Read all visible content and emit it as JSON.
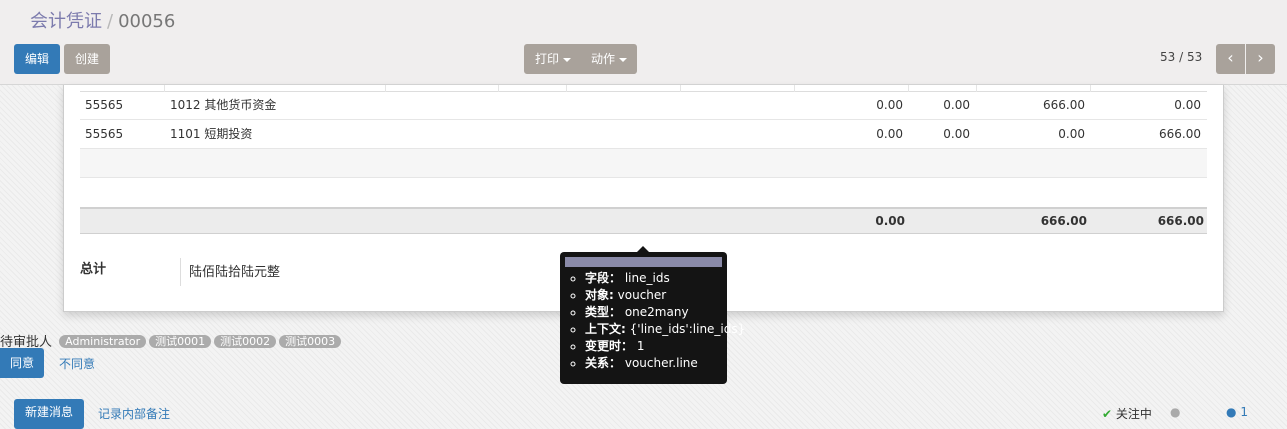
{
  "breadcrumb": {
    "parent": "会计凭证",
    "separator": "/",
    "current": "00056"
  },
  "toolbar": {
    "edit_label": "编辑",
    "create_label": "创建",
    "print_label": "打印",
    "action_label": "动作"
  },
  "pager": {
    "value": "53 / 53",
    "prev_icon": "chevron-left-icon",
    "next_icon": "chevron-right-icon"
  },
  "lines": [
    {
      "code": "55565",
      "account": "1012 其他货币资金",
      "c1": "0.00",
      "c2": "0.00",
      "c3": "666.00",
      "c4": "0.00"
    },
    {
      "code": "55565",
      "account": "1101 短期投资",
      "c1": "0.00",
      "c2": "0.00",
      "c3": "0.00",
      "c4": "666.00"
    }
  ],
  "totals": {
    "t1": "0.00",
    "t2": "666.00",
    "t3": "666.00"
  },
  "summary": {
    "label": "总计",
    "value": "陆佰陆拾陆元整"
  },
  "approval": {
    "label": "待审批人",
    "approvers": [
      "Administrator",
      "测试0001",
      "测试0002",
      "测试0003"
    ],
    "agree_label": "同意",
    "disagree_label": "不同意"
  },
  "chatter": {
    "new_message_label": "新建消息",
    "log_note_label": "记录内部备注",
    "follow_label": "关注中",
    "followers_count": "1"
  },
  "tooltip": {
    "items": [
      {
        "key": "字段：",
        "value": "line_ids"
      },
      {
        "key": "对象:",
        "value": "voucher"
      },
      {
        "key": "类型：",
        "value": "one2many"
      },
      {
        "key": "上下文:",
        "value": "{'line_ids':line_ids}"
      },
      {
        "key": "变更时：",
        "value": "1"
      },
      {
        "key": "关系：",
        "value": "voucher.line"
      }
    ]
  },
  "colors": {
    "primary": "#337ab7",
    "secondary": "#a9a29b",
    "tooltip_bg": "#141414",
    "breadcrumb_link": "#7c7bad"
  }
}
